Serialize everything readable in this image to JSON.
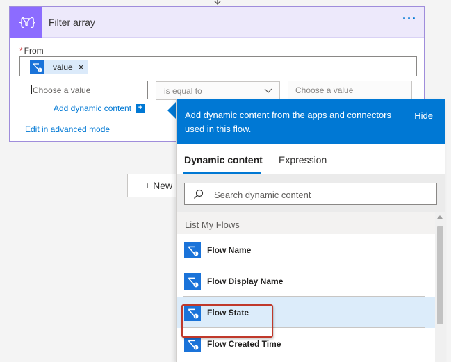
{
  "card": {
    "title": "Filter array",
    "more_label": "···",
    "from_label": "From",
    "required_mark": "*",
    "from_token": {
      "label": "value",
      "remove": "×"
    },
    "left_value_placeholder": "Choose a value",
    "operator": "is equal to",
    "right_value_placeholder": "Choose a value",
    "add_dynamic_content": "Add dynamic content",
    "add_dynamic_plus": "+",
    "advanced_mode": "Edit in advanced mode"
  },
  "new_step_label": "+ New",
  "popup": {
    "header_text": "Add dynamic content from the apps and connectors used in this flow.",
    "hide_label": "Hide",
    "tabs": [
      {
        "label": "Dynamic content",
        "active": true
      },
      {
        "label": "Expression",
        "active": false
      }
    ],
    "search_placeholder": "Search dynamic content",
    "section_title": "List My Flows",
    "items": [
      {
        "label": "Flow Name",
        "selected": false
      },
      {
        "label": "Flow Display Name",
        "selected": false
      },
      {
        "label": "Flow State",
        "selected": true
      },
      {
        "label": "Flow Created Time",
        "selected": false
      }
    ]
  },
  "colors": {
    "accent": "#0078d4",
    "action_purple": "#8c6cff",
    "highlight_red": "#c0392b"
  }
}
